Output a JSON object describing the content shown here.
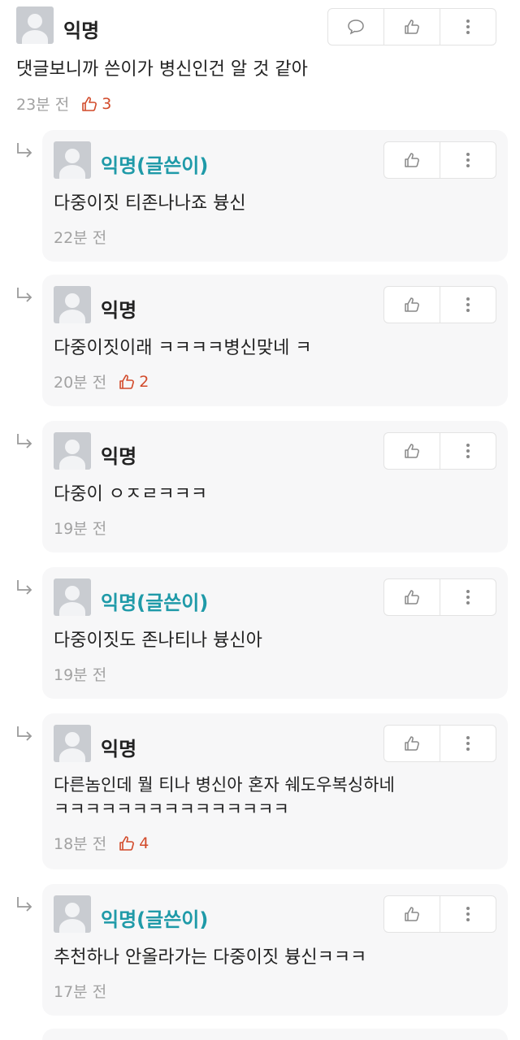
{
  "top_comment": {
    "author": "익명",
    "text": "댓글보니까 쓴이가 병신인건 알 것 같아",
    "time": "23분 전",
    "likes": "3",
    "buttons": [
      "comment-icon",
      "thumbs-up-icon",
      "more-vertical-icon"
    ]
  },
  "replies": [
    {
      "author": "익명(글쓴이)",
      "is_author": true,
      "text": "다중이짓 티존나나죠 븅신",
      "time": "22분 전",
      "likes": ""
    },
    {
      "author": "익명",
      "is_author": false,
      "text": "다중이짓이래 ㅋㅋㅋㅋ병신맞네 ㅋ",
      "time": "20분 전",
      "likes": "2"
    },
    {
      "author": "익명",
      "is_author": false,
      "text": "다중이 ㅇㅈㄹㅋㅋㅋ",
      "time": "19분 전",
      "likes": ""
    },
    {
      "author": "익명(글쓴이)",
      "is_author": true,
      "text": "다중이짓도 존나티나 븅신아",
      "time": "19분 전",
      "likes": ""
    },
    {
      "author": "익명",
      "is_author": false,
      "text": "다른놈인데 뭘 티나 병신아 혼자 쉐도우복싱하네",
      "text2": "ㅋㅋㅋㅋㅋㅋㅋㅋㅋㅋㅋㅋㅋㅋㅋ",
      "time": "18분 전",
      "likes": "4"
    },
    {
      "author": "익명(글쓴이)",
      "is_author": true,
      "text": "추천하나 안올라가는 다중이짓 븅신ㅋㅋㅋ",
      "time": "17분 전",
      "likes": ""
    }
  ],
  "colors": {
    "author_accent": "#1f9aa8",
    "like_accent": "#d24a2a",
    "card_bg": "#f7f7f8"
  }
}
